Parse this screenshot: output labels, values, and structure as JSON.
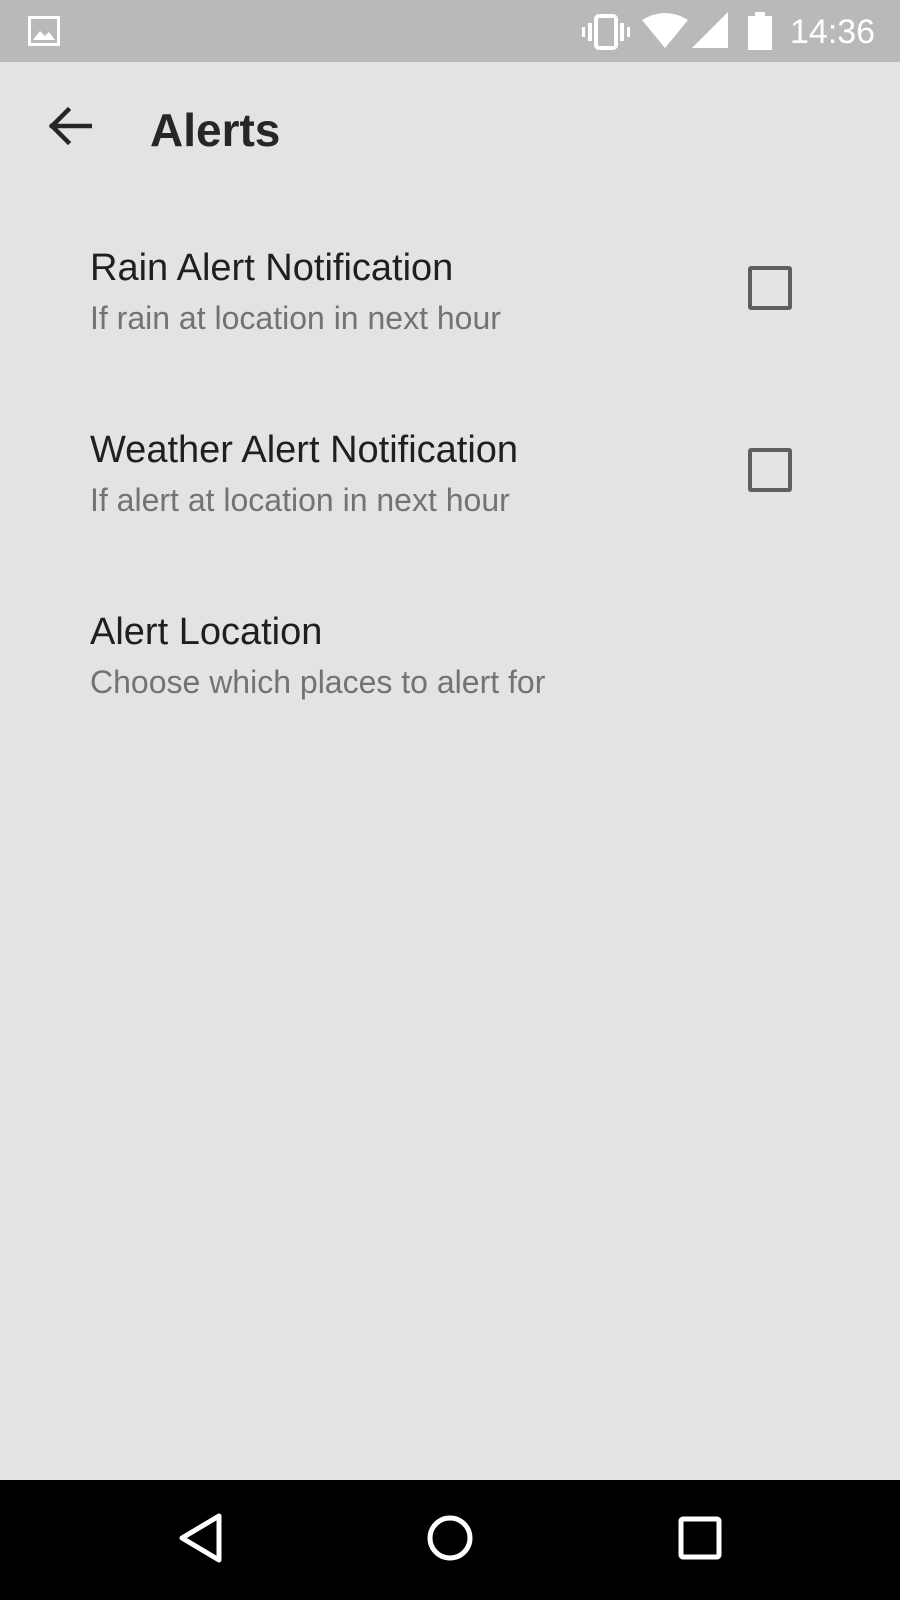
{
  "status_bar": {
    "time": "14:36",
    "icons": [
      "image-thumbnail-icon",
      "vibrate-icon",
      "wifi-icon",
      "cell-signal-icon",
      "battery-icon"
    ]
  },
  "app_bar": {
    "title": "Alerts",
    "back_icon": "arrow-back-icon"
  },
  "preferences": [
    {
      "title": "Rain Alert Notification",
      "summary": "If rain at location in next hour",
      "has_checkbox": true,
      "checked": false
    },
    {
      "title": "Weather Alert Notification",
      "summary": "If alert at location in next hour",
      "has_checkbox": true,
      "checked": false
    },
    {
      "title": "Alert Location",
      "summary": "Choose which places to alert for",
      "has_checkbox": false
    }
  ],
  "nav_bar": {
    "icons": [
      "back-triangle-icon",
      "home-circle-icon",
      "recents-square-icon"
    ]
  },
  "colors": {
    "background": "#e3e3e3",
    "status_bar": "#b9b9b9",
    "nav_bar": "#000000",
    "title_text": "#1f1f1f",
    "summary_text": "#737373"
  }
}
